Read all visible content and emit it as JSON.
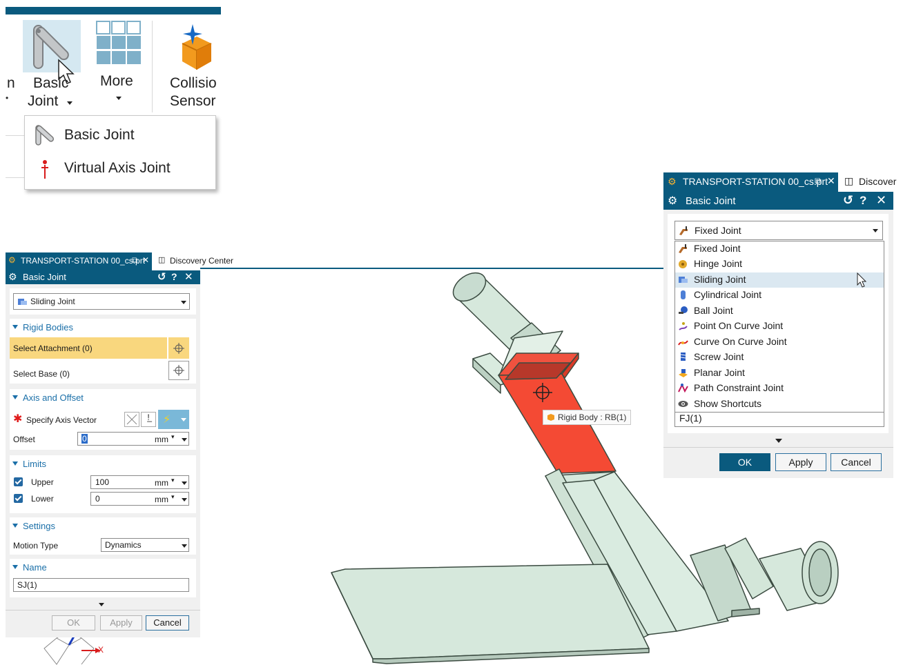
{
  "ribbon": {
    "partial_left_label": "n",
    "partial_left_caret": "•",
    "basic_joint_label_1": "Basic",
    "basic_joint_label_2": "Joint",
    "more_label": "More",
    "collision_label_1": "Collisio",
    "collision_label_2": "Sensor",
    "menu": [
      {
        "label": "Basic Joint",
        "icon": "basic-joint-icon"
      },
      {
        "label": "Virtual Axis Joint",
        "icon": "virtual-axis-icon"
      }
    ]
  },
  "left_dialog": {
    "tab_file": "TRANSPORT-STATION 00_cs.prt",
    "tab_discovery": "Discovery Center",
    "title": "Basic Joint",
    "joint_type": "Sliding Joint",
    "sections": {
      "rigid_bodies": "Rigid Bodies",
      "axis_offset": "Axis and Offset",
      "limits": "Limits",
      "settings": "Settings",
      "name": "Name"
    },
    "select_attachment": "Select Attachment (0)",
    "select_base": "Select Base (0)",
    "specify_axis_vector": "Specify Axis Vector",
    "offset_label": "Offset",
    "offset_value": "0",
    "offset_unit": "mm",
    "upper_label": "Upper",
    "upper_value": "100",
    "upper_unit": "mm",
    "lower_label": "Lower",
    "lower_value": "0",
    "lower_unit": "mm",
    "motion_type_label": "Motion Type",
    "motion_type_value": "Dynamics",
    "name_value": "SJ(1)",
    "ok": "OK",
    "apply": "Apply",
    "cancel": "Cancel"
  },
  "viewport": {
    "tooltip": "Rigid Body : RB(1)",
    "axis_x": "X",
    "highlight_color": "#f44a34",
    "part_color": "#d6e8dc"
  },
  "right_dialog": {
    "tab_file": "TRANSPORT-STATION 00_cs.prt",
    "tab_discovery": "Discover",
    "title": "Basic Joint",
    "selected": "Fixed Joint",
    "options": [
      {
        "label": "Fixed Joint",
        "icon": "fixed-joint-icon"
      },
      {
        "label": "Hinge Joint",
        "icon": "hinge-joint-icon"
      },
      {
        "label": "Sliding Joint",
        "icon": "sliding-joint-icon"
      },
      {
        "label": "Cylindrical Joint",
        "icon": "cylindrical-joint-icon"
      },
      {
        "label": "Ball Joint",
        "icon": "ball-joint-icon"
      },
      {
        "label": "Point On Curve Joint",
        "icon": "point-on-curve-icon"
      },
      {
        "label": "Curve On Curve Joint",
        "icon": "curve-on-curve-icon"
      },
      {
        "label": "Screw Joint",
        "icon": "screw-joint-icon"
      },
      {
        "label": "Planar Joint",
        "icon": "planar-joint-icon"
      },
      {
        "label": "Path Constraint Joint",
        "icon": "path-constraint-icon"
      },
      {
        "label": "Show Shortcuts",
        "icon": "eye-icon"
      }
    ],
    "name_value": "FJ(1)",
    "ok": "OK",
    "apply": "Apply",
    "cancel": "Cancel"
  }
}
